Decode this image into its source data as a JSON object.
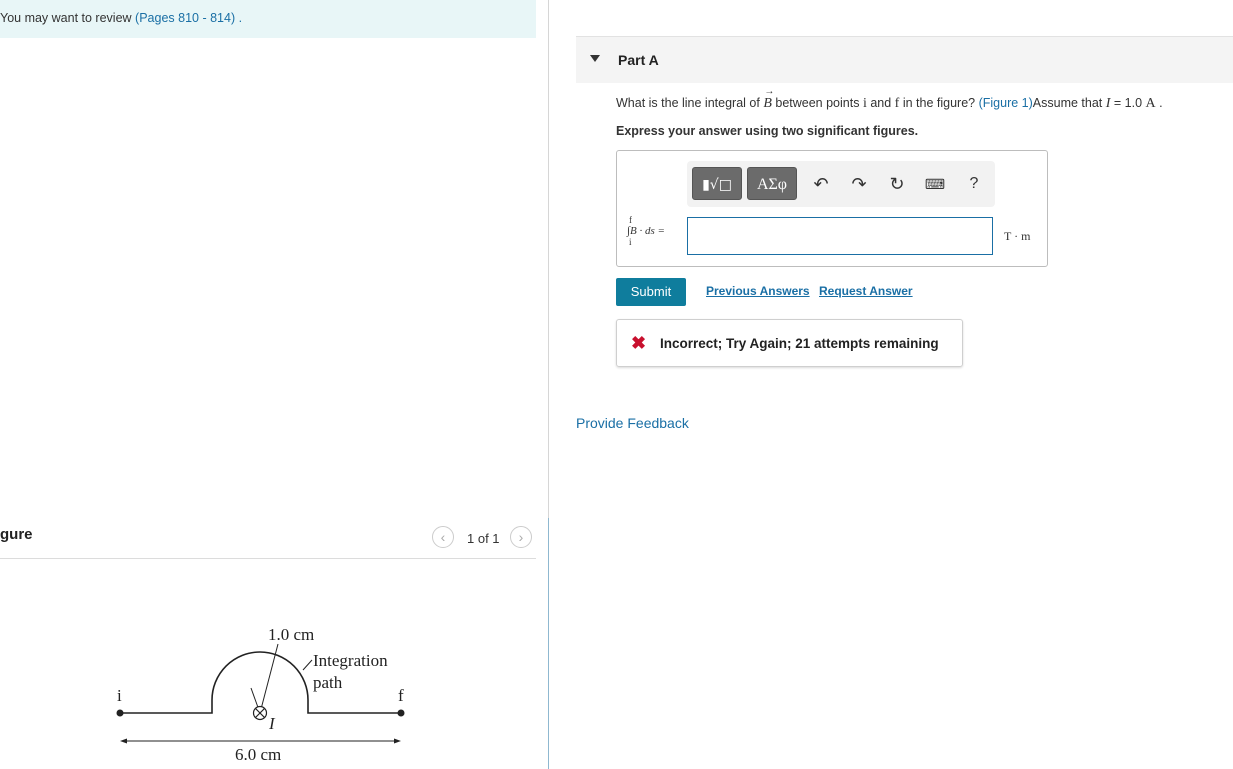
{
  "review": {
    "prefix": "You may want to review",
    "link": "(Pages 810 - 814)",
    "suffix": "."
  },
  "figure_panel": {
    "title": "gure",
    "pager_text": "1 of 1",
    "prev_icon": "chevron-left-icon",
    "next_icon": "chevron-right-icon",
    "labels": {
      "radius": "1.0 cm",
      "path_line1": "Integration",
      "path_line2": "path",
      "point_i": "i",
      "point_f": "f",
      "current": "I",
      "width": "6.0 cm"
    }
  },
  "part": {
    "title": "Part A",
    "question_pre": "What is the line integral of",
    "question_B": "B",
    "question_mid1": "between points",
    "question_i": "i",
    "question_and": "and",
    "question_f": "f",
    "question_mid2": "in the figure?",
    "figure_link": "(Figure 1)",
    "question_assume": "Assume that",
    "question_I": "I",
    "question_value": "= 1.0",
    "question_unit": "A",
    "question_end": ".",
    "instruction": "Express your answer using two significant figures."
  },
  "answer": {
    "toolbar": {
      "template_icon": "templates-icon",
      "greek_label": "ΑΣφ",
      "undo_icon": "undo-icon",
      "redo_icon": "redo-icon",
      "reset_icon": "reset-icon",
      "keyboard_icon": "keyboard-icon",
      "help_label": "?"
    },
    "lhs_upper": "f",
    "lhs_lower": "i",
    "lhs": "∫B · ds =",
    "value": "",
    "unit": "T · m"
  },
  "actions": {
    "submit": "Submit",
    "previous_answers": "Previous Answers",
    "request_answer": "Request Answer"
  },
  "feedback": {
    "status": "Incorrect; Try Again; 21 attempts remaining",
    "status_icon": "x-icon"
  },
  "provide_feedback": "Provide Feedback",
  "colors": {
    "accent": "#0f7d9d",
    "link": "#1a6fa5",
    "error": "#c8102e",
    "banner": "#e8f6f7"
  }
}
